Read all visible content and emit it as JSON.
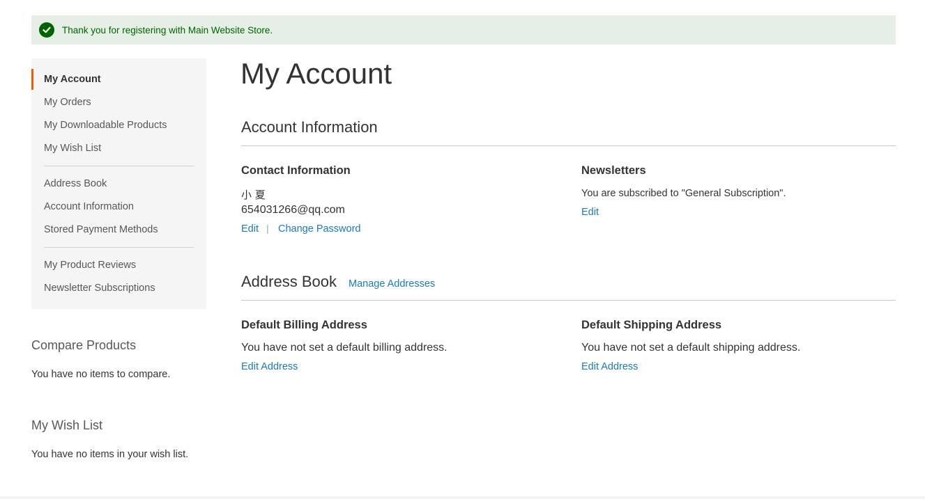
{
  "message": {
    "text": "Thank you for registering with Main Website Store.",
    "icon": "checkmark-icon",
    "color": "#006400",
    "background": "#e5efe5"
  },
  "sidebar": {
    "current": "My Account",
    "group1": [
      "My Orders",
      "My Downloadable Products",
      "My Wish List"
    ],
    "group2": [
      "Address Book",
      "Account Information",
      "Stored Payment Methods"
    ],
    "group3": [
      "My Product Reviews",
      "Newsletter Subscriptions"
    ],
    "accent_color": "#ff5501"
  },
  "compare": {
    "title": "Compare Products",
    "empty_text": "You have no items to compare."
  },
  "wishlist": {
    "title": "My Wish List",
    "empty_text": "You have no items in your wish list."
  },
  "main": {
    "page_title": "My Account",
    "account_info": {
      "title": "Account Information",
      "contact": {
        "title": "Contact Information",
        "name": "小 夏",
        "email": "654031266@qq.com",
        "edit_label": "Edit",
        "separator": "|",
        "change_password_label": "Change Password"
      },
      "newsletters": {
        "title": "Newsletters",
        "text": "You are subscribed to \"General Subscription\".",
        "edit_label": "Edit"
      }
    },
    "address_book": {
      "title": "Address Book",
      "manage_label": "Manage Addresses",
      "billing": {
        "title": "Default Billing Address",
        "text": "You have not set a default billing address.",
        "edit_label": "Edit Address"
      },
      "shipping": {
        "title": "Default Shipping Address",
        "text": "You have not set a default shipping address.",
        "edit_label": "Edit Address"
      }
    }
  },
  "colors": {
    "link": "#1979c3",
    "text": "#333333",
    "sidebar_bg": "#f5f5f5"
  }
}
